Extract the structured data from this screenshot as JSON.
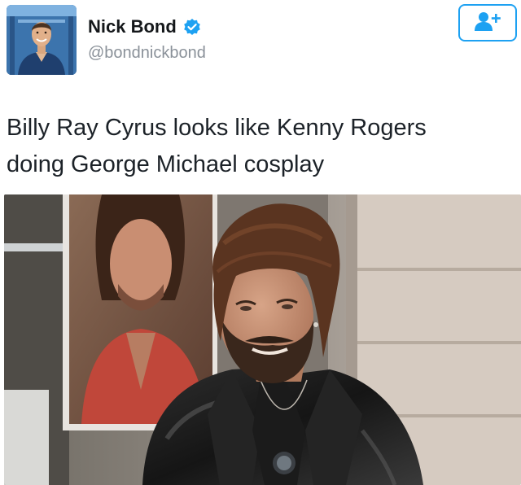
{
  "author": {
    "display_name": "Nick Bond",
    "handle": "@bondnickbond",
    "verified": true,
    "verified_icon": "verified-badge-icon",
    "avatar_icon": "profile-photo"
  },
  "follow_button": {
    "icon": "add-user-icon"
  },
  "tweet": {
    "text_line1": "Billy Ray Cyrus looks like Kenny Rogers",
    "text_line2": "doing George Michael cosplay"
  },
  "media": {
    "type": "photo"
  },
  "colors": {
    "accent": "#1da1f2",
    "text": "#14171a",
    "secondary": "#8a9199"
  }
}
